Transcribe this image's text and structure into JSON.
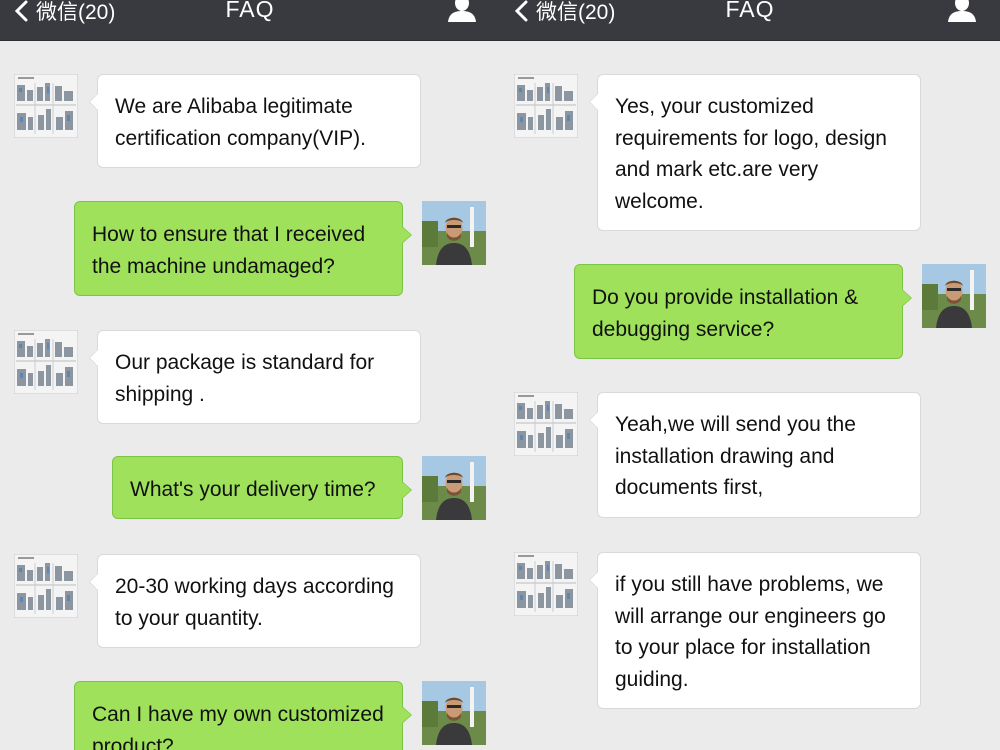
{
  "header": {
    "back_label": "微信(20)",
    "title": "FAQ"
  },
  "colors": {
    "header_bg": "#393a3f",
    "chat_bg": "#ebebeb",
    "incoming_bubble": "#ffffff",
    "outgoing_bubble": "#9fe15a"
  },
  "icons": {
    "back": "chevron-left-icon",
    "profile": "person-icon",
    "company_avatar": "machine-catalog-thumbnail",
    "user_avatar": "person-photo"
  },
  "left_messages": [
    {
      "side": "in",
      "text": "We are Alibaba legitimate certification company(VIP)."
    },
    {
      "side": "out",
      "text": "How to ensure that I received the machine undamaged?"
    },
    {
      "side": "in",
      "text": "Our package is standard for shipping ."
    },
    {
      "side": "out",
      "text": "What's your delivery time?"
    },
    {
      "side": "in",
      "text": "20-30 working days according to your quantity."
    },
    {
      "side": "out",
      "text": "Can I have my own customized product?"
    }
  ],
  "right_messages": [
    {
      "side": "in",
      "text": "Yes, your customized requirements for logo, design and mark etc.are very welcome."
    },
    {
      "side": "out",
      "text": "Do you provide installation & debugging service?"
    },
    {
      "side": "in",
      "text": "Yeah,we will send you the installation drawing and documents first,"
    },
    {
      "side": "in",
      "text": "if you still have problems, we will arrange our engineers go to your place for installation guiding."
    }
  ]
}
